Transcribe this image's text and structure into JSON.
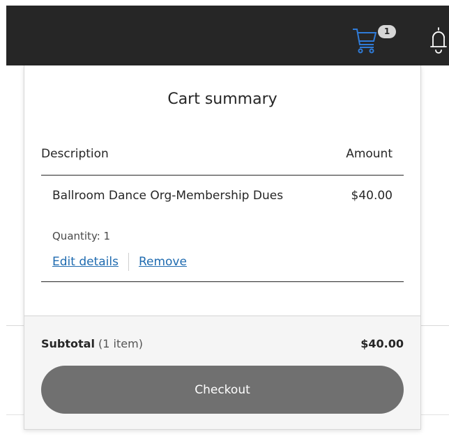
{
  "header": {
    "cart": {
      "icon": "shopping-cart-icon",
      "badge_count": "1",
      "icon_color": "#2f7bd8"
    },
    "notifications": {
      "icon": "bell-icon"
    }
  },
  "cart_summary": {
    "title": "Cart summary",
    "columns": {
      "description": "Description",
      "amount": "Amount"
    },
    "items": [
      {
        "name": "Ballroom Dance Org-Membership Dues",
        "amount": "$40.00",
        "quantity": "Quantity: 1",
        "edit_label": "Edit details",
        "remove_label": "Remove"
      }
    ],
    "subtotal": {
      "label": "Subtotal",
      "count": "(1 item)",
      "value": "$40.00"
    },
    "checkout_label": "Checkout"
  },
  "colors": {
    "topbar": "#262626",
    "link": "#1f6bb0",
    "checkout_button": "#707070",
    "footer_bg": "#f5f5f5"
  }
}
